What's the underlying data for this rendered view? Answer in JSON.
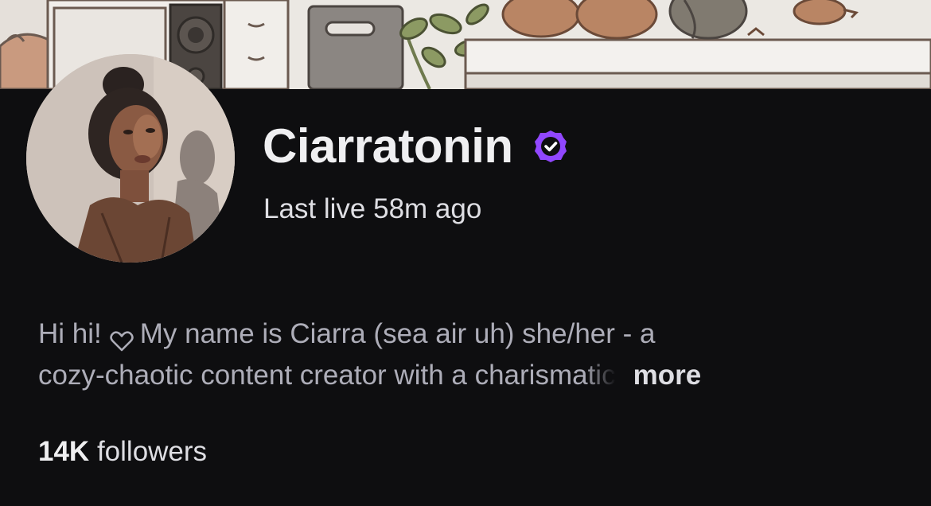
{
  "channel": {
    "name": "Ciarratonin",
    "verified": true,
    "status": "Last live 58m ago",
    "avatar_icon": "avatar-photo"
  },
  "bio": {
    "line1_part1": "Hi hi!",
    "line1_part2": "My name is Ciarra (sea air uh) she/her - a",
    "line2": "cozy-chaotic content creator with a charismatic",
    "more_label": "more",
    "heart_icon": "heart-outline-icon"
  },
  "followers": {
    "count": "14K",
    "label": "followers"
  },
  "colors": {
    "background": "#0e0e10",
    "accent": "#9147ff",
    "text_primary": "#efeff1",
    "text_secondary": "#adadb8"
  }
}
